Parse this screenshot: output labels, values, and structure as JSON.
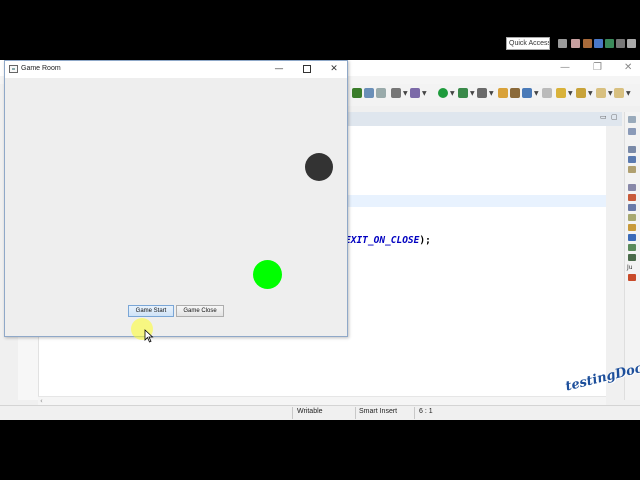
{
  "game_window": {
    "title": "Game Room",
    "minimize_glyph": "—",
    "close_glyph": "✕",
    "icon": "java-window-icon",
    "buttons": {
      "start_label": "Game Start",
      "close_label": "Game Close"
    },
    "balls": [
      {
        "name": "dark-ball",
        "color": "#333333"
      },
      {
        "name": "green-ball",
        "color": "#00ff00"
      }
    ]
  },
  "ide": {
    "quick_access_label": "Quick Access",
    "code_visible": "EXIT_ON_CLOSE",
    "code_suffix": ");",
    "status": {
      "mode": "Writable",
      "insert_mode": "Smart Insert",
      "position": "6 : 1"
    }
  },
  "watermark": "testingDocs.com"
}
